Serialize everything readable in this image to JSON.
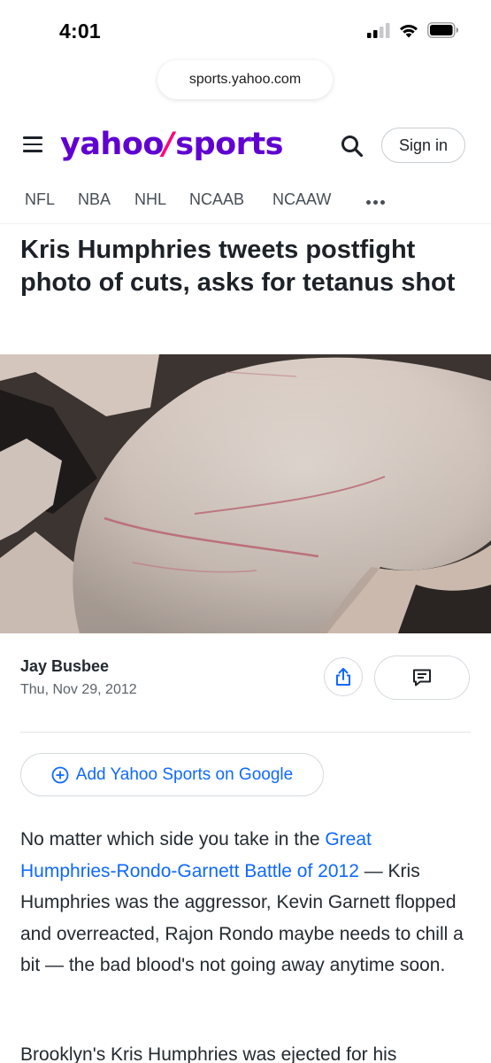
{
  "status_bar": {
    "time": "4:01"
  },
  "browser": {
    "url": "sports.yahoo.com"
  },
  "header": {
    "logo_yahoo": "yahoo",
    "logo_slash": "/",
    "logo_sports": "sports",
    "signin_label": "Sign in",
    "brand_color": "#6001d2"
  },
  "nav": {
    "items": [
      "NFL",
      "NBA",
      "NHL",
      "NCAAB",
      "NCAAW"
    ]
  },
  "article": {
    "headline": "Kris Humphries tweets postfight photo of cuts, asks for tetanus shot",
    "author": "Jay Busbee",
    "date": "Thu, Nov 29, 2012",
    "google_cta": "Add Yahoo Sports on Google",
    "paragraph1_pre": "No matter which side you take in the ",
    "paragraph1_link": "Great Humphries-Rondo-Garnett Battle of 2012",
    "paragraph1_post": " — Kris Humphries was the aggressor, Kevin Garnett flopped and overreacted, Rajon Rondo maybe needs to chill a bit — the bad blood's not going away anytime soon.",
    "paragraph2": "Brooklyn's Kris Humphries was ejected for his",
    "link_color": "#0f69ff"
  }
}
